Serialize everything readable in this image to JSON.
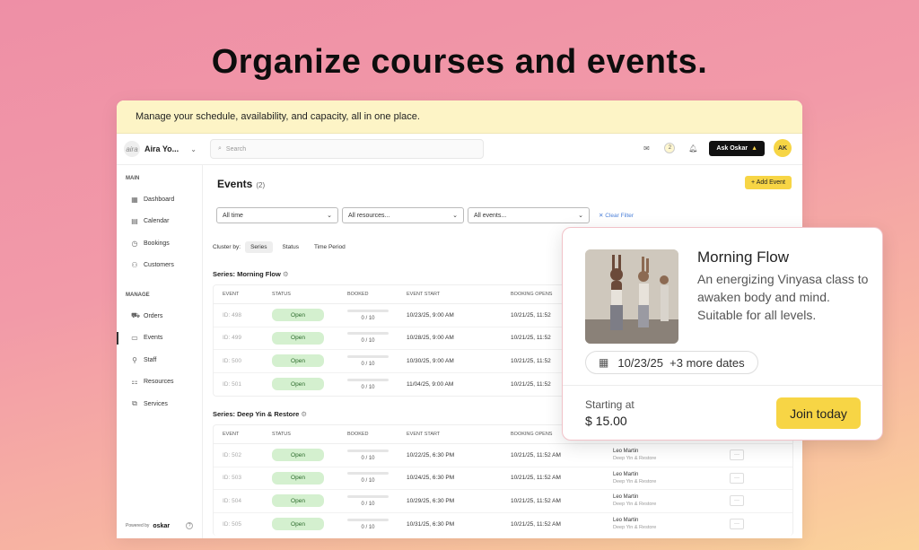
{
  "headline": "Organize courses and events.",
  "banner": "Manage your schedule, availability, and capacity, all in one place.",
  "topbar": {
    "brand_logo": "aira",
    "brand_name": "Aira Yo...",
    "search_placeholder": "Search",
    "notification_count": "2",
    "ask_button": "Ask Oskar",
    "avatar_initials": "AK"
  },
  "sidebar": {
    "main_section": "MAIN",
    "main_items": [
      {
        "label": "Dashboard",
        "icon": "dashboard-icon"
      },
      {
        "label": "Calendar",
        "icon": "calendar-icon"
      },
      {
        "label": "Bookings",
        "icon": "bookings-icon"
      },
      {
        "label": "Customers",
        "icon": "customers-icon"
      }
    ],
    "manage_section": "MANAGE",
    "manage_items": [
      {
        "label": "Orders",
        "icon": "cart-icon"
      },
      {
        "label": "Events",
        "icon": "events-icon",
        "active": true
      },
      {
        "label": "Staff",
        "icon": "staff-icon"
      },
      {
        "label": "Resources",
        "icon": "resources-icon"
      },
      {
        "label": "Services",
        "icon": "services-icon"
      }
    ],
    "powered_by": "Powered by",
    "powered_brand": "oskar"
  },
  "main": {
    "title": "Events",
    "count": "(2)",
    "add_event": "+ Add Event",
    "filters": [
      "All time",
      "All resources...",
      "All events..."
    ],
    "clear_filter": "✕ Clear Filter",
    "cluster_label": "Cluster by:",
    "cluster_options": [
      "Series",
      "Status",
      "Time Period"
    ],
    "columns": [
      "EVENT",
      "STATUS",
      "BOOKED",
      "EVENT START",
      "BOOKING OPENS"
    ],
    "series": [
      {
        "title": "Series: Morning Flow",
        "rows": [
          {
            "id": "ID: 498",
            "status": "Open",
            "booked": "0 / 10",
            "start": "10/23/25, 9:00 AM",
            "opens": "10/21/25, 11:52"
          },
          {
            "id": "ID: 499",
            "status": "Open",
            "booked": "0 / 10",
            "start": "10/28/25, 9:00 AM",
            "opens": "10/21/25, 11:52"
          },
          {
            "id": "ID: 500",
            "status": "Open",
            "booked": "0 / 10",
            "start": "10/30/25, 9:00 AM",
            "opens": "10/21/25, 11:52"
          },
          {
            "id": "ID: 501",
            "status": "Open",
            "booked": "0 / 10",
            "start": "11/04/25, 9:00 AM",
            "opens": "10/21/25, 11:52"
          }
        ]
      },
      {
        "title": "Series: Deep Yin & Restore",
        "rows": [
          {
            "id": "ID: 502",
            "status": "Open",
            "booked": "0 / 10",
            "start": "10/22/25, 6:30 PM",
            "opens": "10/21/25, 11:52 AM",
            "staff": "Leo Martin",
            "service": "Deep Yin & Restore"
          },
          {
            "id": "ID: 503",
            "status": "Open",
            "booked": "0 / 10",
            "start": "10/24/25, 6:30 PM",
            "opens": "10/21/25, 11:52 AM",
            "staff": "Leo Martin",
            "service": "Deep Yin & Restore"
          },
          {
            "id": "ID: 504",
            "status": "Open",
            "booked": "0 / 10",
            "start": "10/29/25, 6:30 PM",
            "opens": "10/21/25, 11:52 AM",
            "staff": "Leo Martin",
            "service": "Deep Yin & Restore"
          },
          {
            "id": "ID: 505",
            "status": "Open",
            "booked": "0 / 10",
            "start": "10/31/25, 6:30 PM",
            "opens": "10/21/25, 11:52 AM",
            "staff": "Leo Martin",
            "service": "Deep Yin & Restore"
          }
        ]
      }
    ],
    "row_menu": "···"
  },
  "card": {
    "title": "Morning Flow",
    "description": "An energizing Vinyasa class to awaken body and mind. Suitable for all levels.",
    "dates": "10/23/25  +3 more dates",
    "starting_label": "Starting at",
    "price": "$ 15.00",
    "cta": "Join today"
  },
  "colors": {
    "accent": "#f7d545",
    "open_status_bg": "#d4f0cf",
    "banner_bg": "#fdf4c6"
  }
}
